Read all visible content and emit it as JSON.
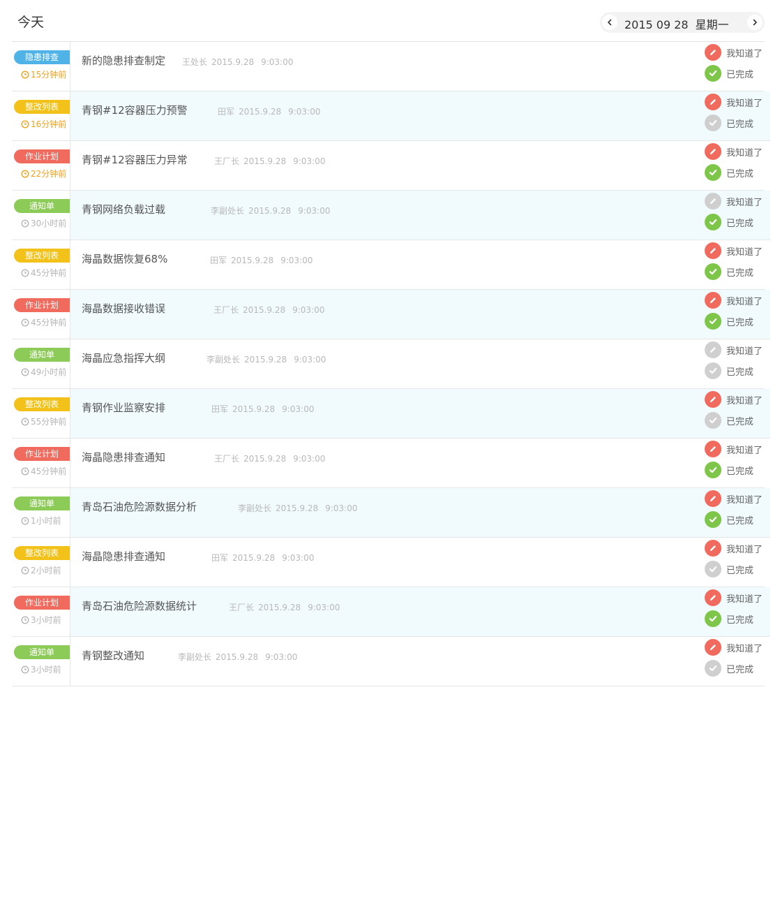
{
  "header": {
    "title": "今天",
    "date": "2015 09 28",
    "weekday": "星期一"
  },
  "colors": {
    "blue": "#4fb3e8",
    "yellow": "#f2c21a",
    "red": "#f16a5e",
    "green": "#8dcb58",
    "recent_time": "#f0a11a",
    "alt_row_bg": "#f1fbfe"
  },
  "actions": {
    "ack_label": "我知道了",
    "done_label": "已完成"
  },
  "items": [
    {
      "tag": "隐患排查",
      "tag_color": "blue",
      "time": "15分钟前",
      "recent": true,
      "title": "新的隐患排查制定",
      "person": "王处长",
      "date": "2015.9.28",
      "clock": "9:03:00",
      "ack": "active",
      "done": "active",
      "alt": false
    },
    {
      "tag": "整改列表",
      "tag_color": "yellow",
      "time": "16分钟前",
      "recent": true,
      "title": "青钢#12容器压力预警",
      "person": "田军",
      "date": "2015.9.28",
      "clock": "9:03:00",
      "ack": "active",
      "done": "inactive",
      "alt": true
    },
    {
      "tag": "作业计划",
      "tag_color": "red",
      "time": "22分钟前",
      "recent": true,
      "title": "青钢#12容器压力异常",
      "person": "王厂长",
      "date": "2015.9.28",
      "clock": "9:03:00",
      "ack": "active",
      "done": "active",
      "alt": false
    },
    {
      "tag": "通知单",
      "tag_color": "green",
      "time": "30小时前",
      "recent": false,
      "title": "青钢网络负载过载",
      "person": "李副处长",
      "date": "2015.9.28",
      "clock": "9:03:00",
      "ack": "inactive",
      "done": "active",
      "alt": true
    },
    {
      "tag": "整改列表",
      "tag_color": "yellow",
      "time": "45分钟前",
      "recent": false,
      "title": "海晶数据恢复68%",
      "person": "田军",
      "date": "2015.9.28",
      "clock": "9:03:00",
      "ack": "active",
      "done": "active",
      "alt": false
    },
    {
      "tag": "作业计划",
      "tag_color": "red",
      "time": "45分钟前",
      "recent": false,
      "title": "海晶数据接收错误",
      "person": "王厂长",
      "date": "2015.9.28",
      "clock": "9:03:00",
      "ack": "active",
      "done": "active",
      "alt": true
    },
    {
      "tag": "通知单",
      "tag_color": "green",
      "time": "49小时前",
      "recent": false,
      "title": "海晶应急指挥大纲",
      "person": "李副处长",
      "date": "2015.9.28",
      "clock": "9:03:00",
      "ack": "inactive",
      "done": "inactive",
      "alt": false
    },
    {
      "tag": "整改列表",
      "tag_color": "yellow",
      "time": "55分钟前",
      "recent": false,
      "title": "青钢作业监察安排",
      "person": "田军",
      "date": "2015.9.28",
      "clock": "9:03:00",
      "ack": "active",
      "done": "inactive",
      "alt": true
    },
    {
      "tag": "作业计划",
      "tag_color": "red",
      "time": "45分钟前",
      "recent": false,
      "title": "海晶隐患排查通知",
      "person": "王厂长",
      "date": "2015.9.28",
      "clock": "9:03:00",
      "ack": "active",
      "done": "active",
      "alt": false
    },
    {
      "tag": "通知单",
      "tag_color": "green",
      "time": "1小时前",
      "recent": false,
      "title": "青岛石油危险源数据分析",
      "person": "李副处长",
      "date": "2015.9.28",
      "clock": "9:03:00",
      "ack": "active",
      "done": "active",
      "alt": true
    },
    {
      "tag": "整改列表",
      "tag_color": "yellow",
      "time": "2小时前",
      "recent": false,
      "title": "海晶隐患排查通知",
      "person": "田军",
      "date": "2015.9.28",
      "clock": "9:03:00",
      "ack": "active",
      "done": "inactive",
      "alt": false
    },
    {
      "tag": "作业计划",
      "tag_color": "red",
      "time": "3小时前",
      "recent": false,
      "title": "青岛石油危险源数据统计",
      "person": "王厂长",
      "date": "2015.9.28",
      "clock": "9:03:00",
      "ack": "active",
      "done": "active",
      "alt": true
    },
    {
      "tag": "通知单",
      "tag_color": "green",
      "time": "3小时前",
      "recent": false,
      "title": "青钢整改通知",
      "person": "李副处长",
      "date": "2015.9.28",
      "clock": "9:03:00",
      "ack": "active",
      "done": "inactive",
      "alt": false
    }
  ]
}
